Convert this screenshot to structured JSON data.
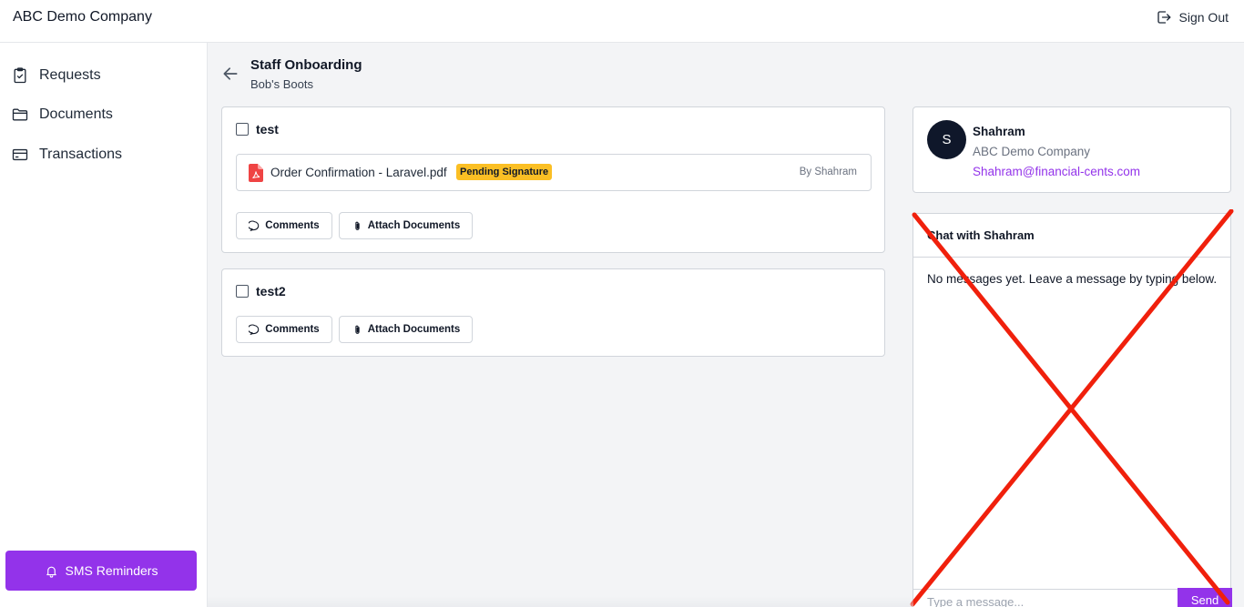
{
  "app": {
    "company": "ABC Demo Company",
    "sign_out_label": "Sign Out"
  },
  "sidebar": {
    "items": [
      {
        "label": "Requests",
        "icon": "clipboard-check-icon"
      },
      {
        "label": "Documents",
        "icon": "folder-icon"
      },
      {
        "label": "Transactions",
        "icon": "credit-card-icon"
      }
    ],
    "sms_button_label": "SMS Reminders"
  },
  "header": {
    "title": "Staff Onboarding",
    "subtitle": "Bob's Boots"
  },
  "tasks": [
    {
      "title": "test",
      "checked": false,
      "document": {
        "name": "Order Confirmation - Laravel.pdf",
        "status": "Pending Signature",
        "by": "By Shahram"
      },
      "comments_label": "Comments",
      "attach_label": "Attach Documents"
    },
    {
      "title": "test2",
      "checked": false,
      "comments_label": "Comments",
      "attach_label": "Attach Documents"
    }
  ],
  "contact": {
    "initial": "S",
    "name": "Shahram",
    "company": "ABC Demo Company",
    "email": "Shahram@financial-cents.com"
  },
  "chat": {
    "title": "Chat with Shahram",
    "empty_message": "No messages yet. Leave a message by typing below.",
    "input_placeholder": "Type a message...",
    "send_label": "Send"
  },
  "colors": {
    "accent": "#9333ea",
    "badge": "#fbbf24",
    "cross": "#f0200c",
    "avatar": "#0f172a"
  }
}
